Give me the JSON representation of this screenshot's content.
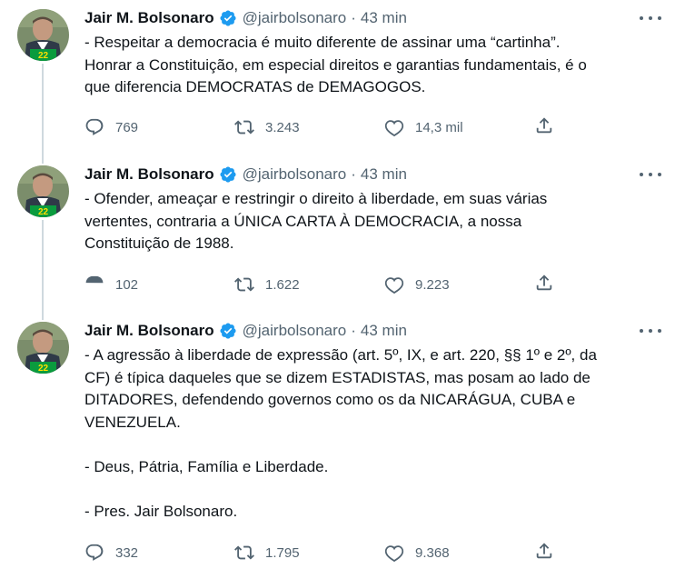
{
  "tweets": [
    {
      "name": "Jair M. Bolsonaro",
      "handle": "@jairbolsonaro",
      "separator": "·",
      "time": "43 min",
      "text": "- Respeitar a democracia é muito diferente de assinar uma “cartinha”.\nHonrar a Constituição, em especial direitos e garantias fundamentais, é o\nque diferencia DEMOCRATAS de DEMAGOGOS.",
      "replies": "769",
      "retweets": "3.243",
      "likes": "14,3 mil"
    },
    {
      "name": "Jair M. Bolsonaro",
      "handle": "@jairbolsonaro",
      "separator": "·",
      "time": "43 min",
      "text": "- Ofender, ameaçar e restringir o direito à liberdade, em suas várias\nvertentes, contraria a ÚNICA CARTA À DEMOCRACIA, a nossa\nConstituição de 1988.",
      "replies": "102",
      "retweets": "1.622",
      "likes": "9.223"
    },
    {
      "name": "Jair M. Bolsonaro",
      "handle": "@jairbolsonaro",
      "separator": "·",
      "time": "43 min",
      "text": "- A agressão à liberdade de expressão (art. 5º, IX, e art. 220, §§ 1º e 2º, da\nCF) é típica daqueles que se dizem ESTADISTAS, mas posam ao lado de\nDITADORES, defendendo governos como os da NICARÁGUA, CUBA e\nVENEZUELA.\n\n- Deus, Pátria, Família e Liberdade.\n\n- Pres. Jair Bolsonaro.",
      "replies": "332",
      "retweets": "1.795",
      "likes": "9.368"
    }
  ],
  "icons": {
    "verified": "verified-badge-icon",
    "more": "more-options-icon",
    "reply": "reply-icon",
    "retweet": "retweet-icon",
    "like": "like-icon",
    "share": "share-icon"
  },
  "colors": {
    "text": "#0f1419",
    "secondary": "#536471",
    "verified": "#1d9bf0",
    "thread_line": "#cfd9de"
  }
}
